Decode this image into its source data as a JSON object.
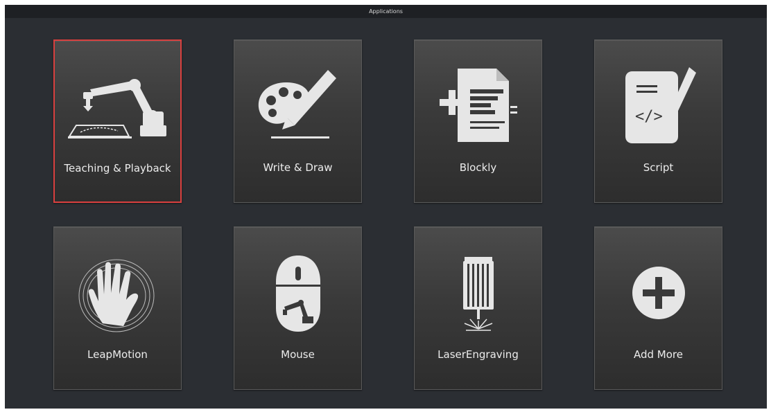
{
  "window": {
    "title": "Applications"
  },
  "tiles": [
    {
      "label": "Teaching & Playback",
      "icon": "robot-arm-icon",
      "selected": true
    },
    {
      "label": "Write & Draw",
      "icon": "palette-pencil-icon"
    },
    {
      "label": "Blockly",
      "icon": "blockly-document-icon"
    },
    {
      "label": "Script",
      "icon": "script-document-icon"
    },
    {
      "label": "LeapMotion",
      "icon": "hand-icon"
    },
    {
      "label": "Mouse",
      "icon": "mouse-icon"
    },
    {
      "label": "LaserEngraving",
      "icon": "laser-icon"
    },
    {
      "label": "Add More",
      "icon": "plus-circle-icon"
    }
  ],
  "colors": {
    "background": "#2b2e33",
    "titlebar": "#1e2024",
    "selected_border": "#d9403f",
    "icon": "#e6e6e6"
  }
}
